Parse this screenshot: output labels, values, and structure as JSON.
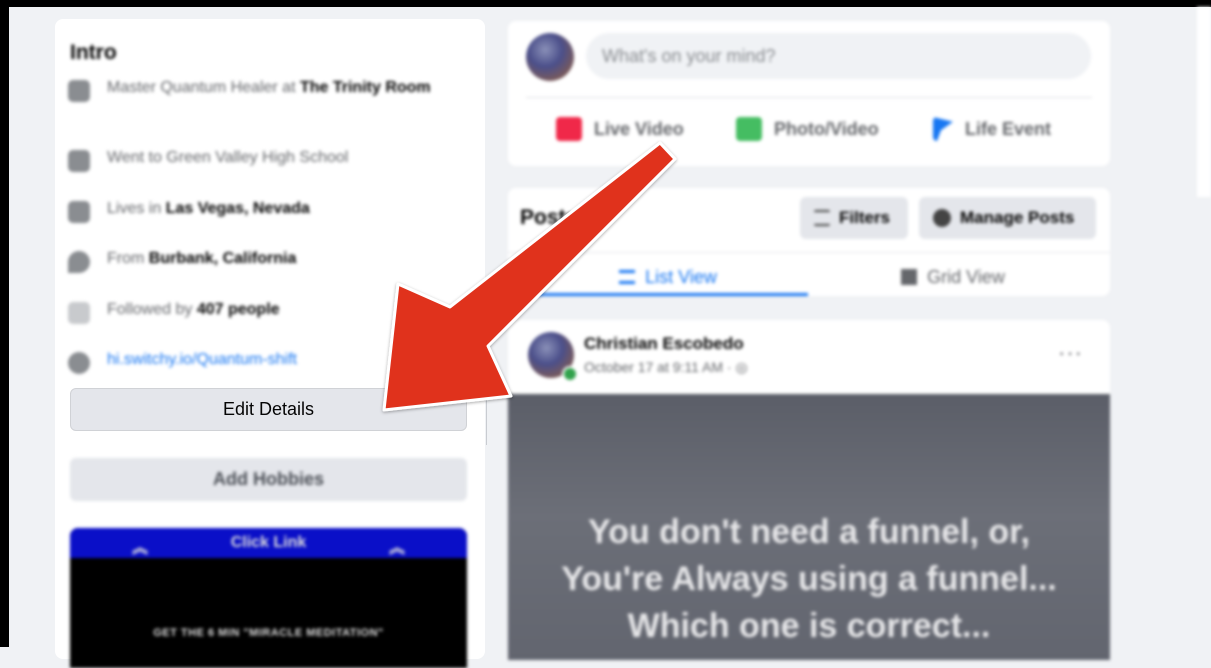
{
  "intro": {
    "title": "Intro",
    "rows": [
      {
        "prefix": "Master Quantum Healer at ",
        "bold": "The Trinity Room",
        "icon": "briefcase-icon"
      },
      {
        "prefix": "Went to Green Valley High School",
        "bold": "",
        "icon": "graduation-cap-icon"
      },
      {
        "prefix": "Lives in ",
        "bold": "Las Vegas, Nevada",
        "icon": "home-icon"
      },
      {
        "prefix": "From ",
        "bold": "Burbank, California",
        "icon": "location-pin-icon"
      },
      {
        "prefix": "Followed by ",
        "bold": "407 people",
        "icon": "rss-icon"
      },
      {
        "link": "hi.switchy.io/Quantum-shift",
        "icon": "globe-icon"
      }
    ],
    "edit_details_label": "Edit Details",
    "add_hobbies_label": "Add Hobbies",
    "featured": {
      "bar_text": "Click Link",
      "caption": "GET THE 6 MIN \"MIRACLE MEDITATION\""
    }
  },
  "composer": {
    "placeholder": "What's on your mind?",
    "actions": [
      {
        "label": "Live Video",
        "icon": "live-video-icon",
        "color": "#f02849"
      },
      {
        "label": "Photo/Video",
        "icon": "photo-video-icon",
        "color": "#45bd62"
      },
      {
        "label": "Life Event",
        "icon": "life-event-flag-icon",
        "color": "#1877f2"
      }
    ]
  },
  "posts": {
    "title": "Posts",
    "filters_label": "Filters",
    "manage_label": "Manage Posts",
    "list_view_label": "List View",
    "grid_view_label": "Grid View"
  },
  "post": {
    "author": "Christian Escobedo",
    "time": "October 17 at 9:11 AM · ",
    "more": "···",
    "quote_lines": [
      "You don't need a funnel, or,",
      "You're Always using a funnel...",
      "Which one is correct..."
    ]
  },
  "annotation": {
    "arrow_color": "#e0301e"
  }
}
